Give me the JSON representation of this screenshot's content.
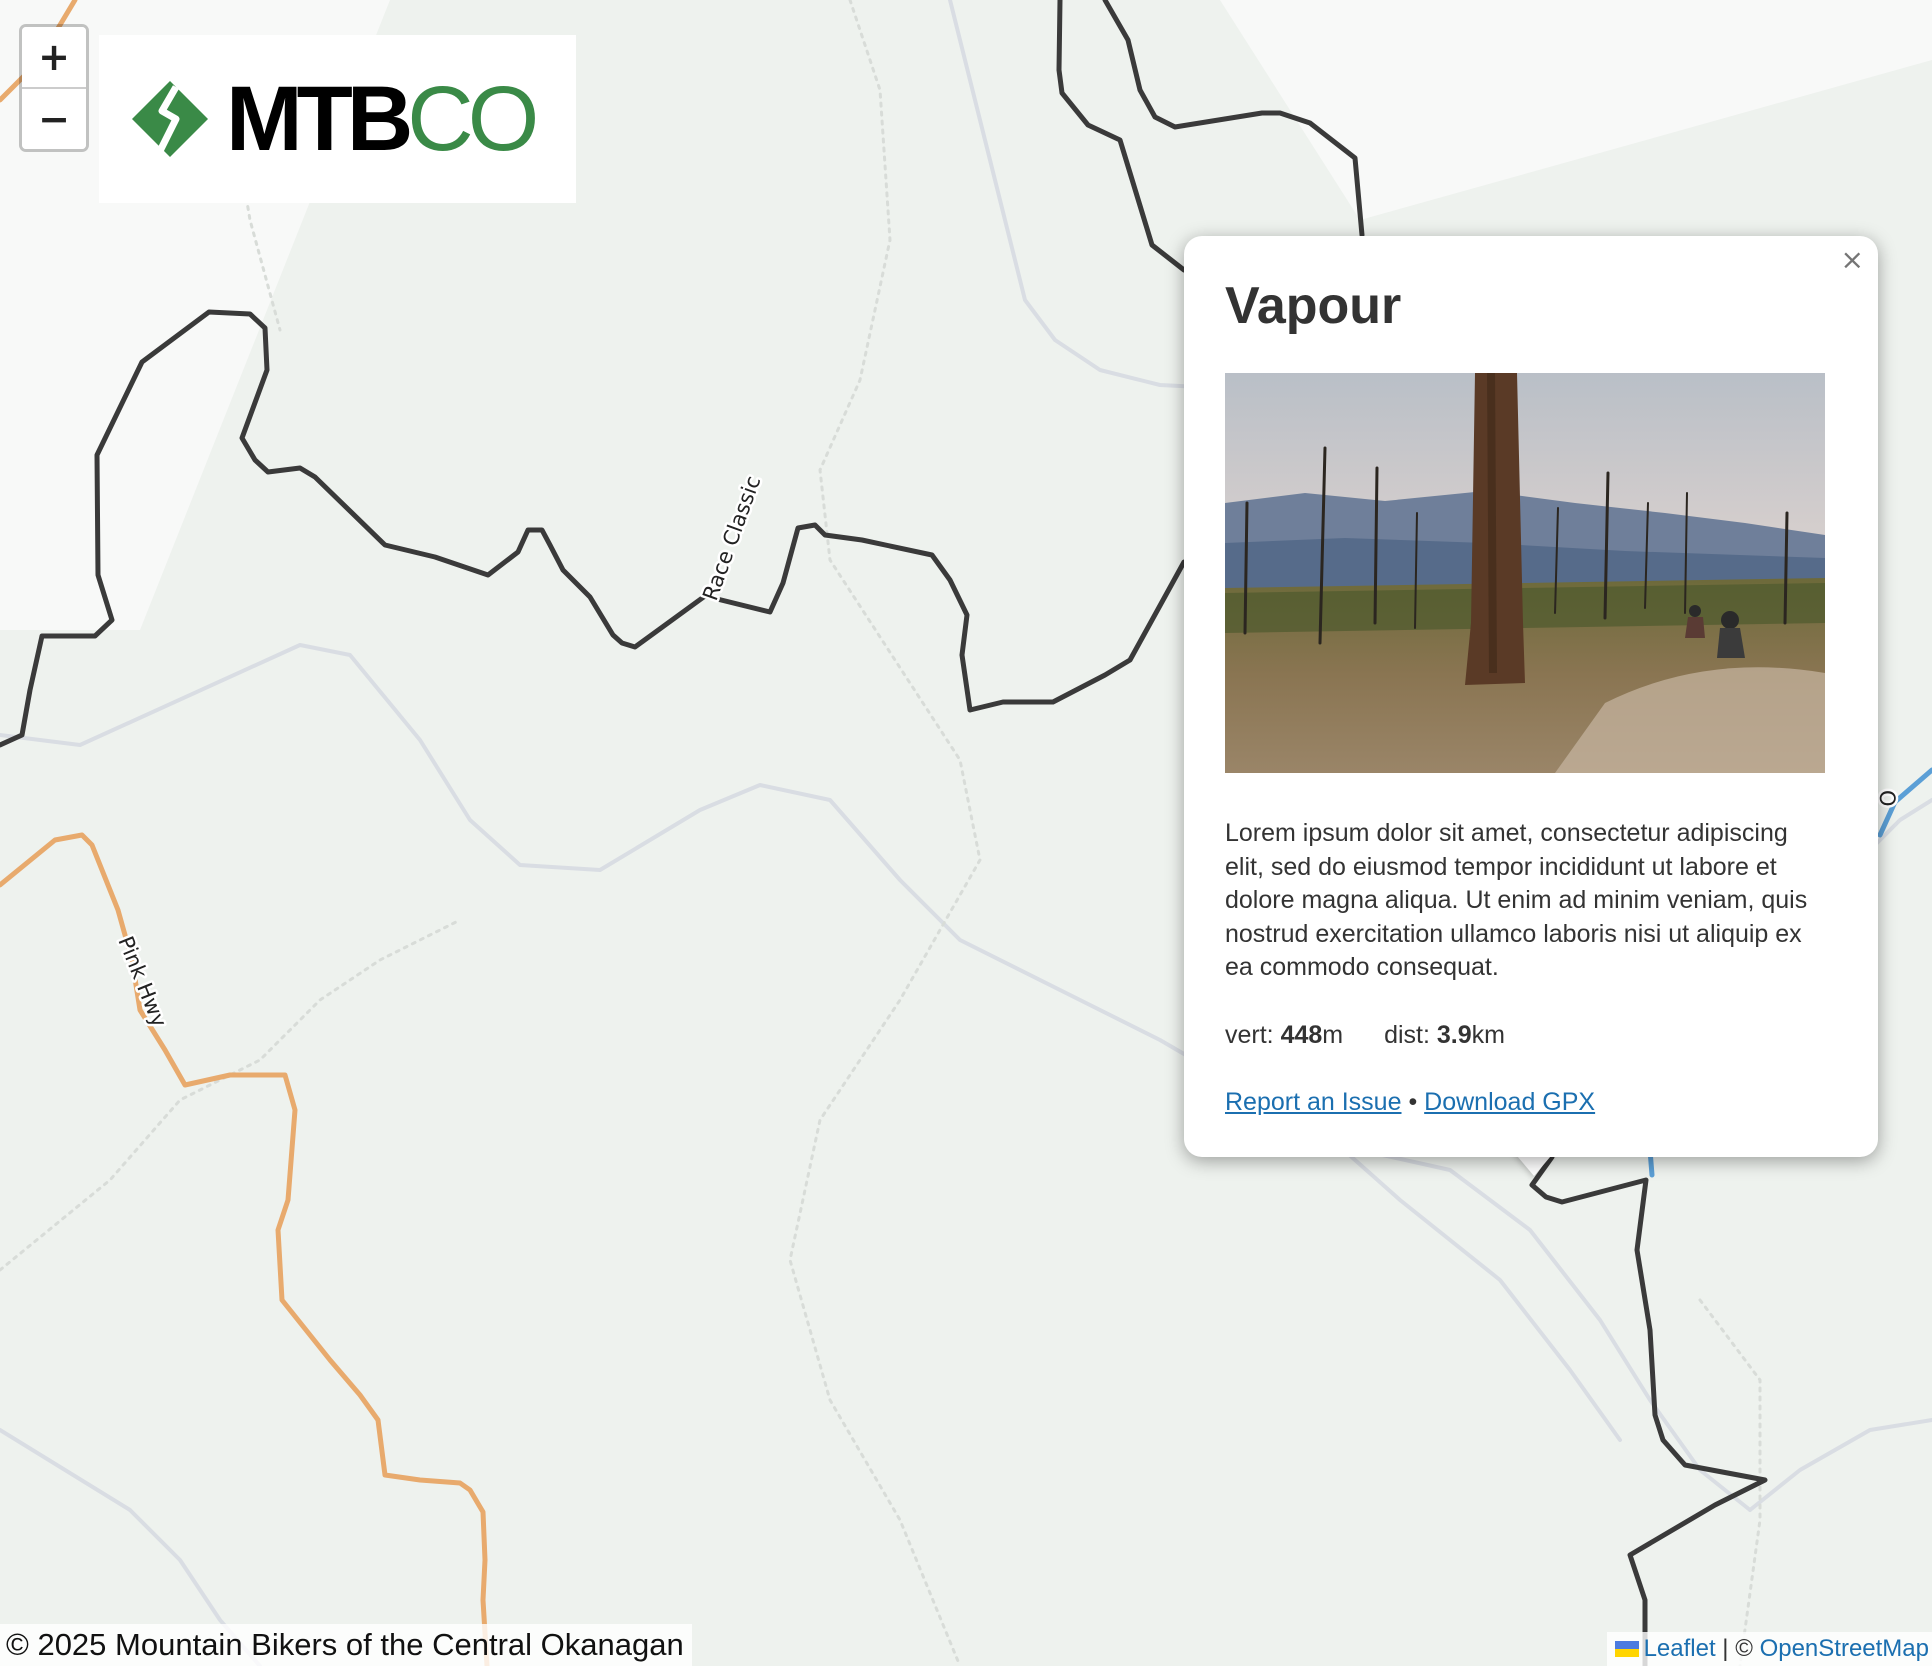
{
  "map": {
    "zoom_in_label": "+",
    "zoom_out_label": "−",
    "trail_labels": {
      "race_classic": "Race Classic",
      "pink_hwy": "Pink Hwy",
      "edge_label": "O"
    }
  },
  "logo": {
    "mtb_text": "MTB",
    "co_text": "CO",
    "brand_green": "#3a8a47"
  },
  "popup": {
    "close_label": "×",
    "title": "Vapour",
    "photo_icon": "trail-photo",
    "description": "Lorem ipsum dolor sit amet, consectetur adipiscing elit, sed do eiusmod tempor incididunt ut labore et dolore magna aliqua. Ut enim ad minim veniam, quis nostrud exercitation ullamco laboris nisi ut aliquip ex ea commodo consequat.",
    "stats": {
      "vert_label": "vert:",
      "vert_value": "448",
      "vert_unit": "m",
      "dist_label": "dist:",
      "dist_value": "3.9",
      "dist_unit": "km"
    },
    "links": {
      "report": "Report an Issue",
      "separator": "•",
      "download": "Download GPX"
    }
  },
  "attribution": {
    "copyright": "© 2025 Mountain Bikers of the Central Okanagan",
    "leaflet": "Leaflet",
    "separator": "|",
    "osm_prefix": "©",
    "osm": "OpenStreetMap"
  },
  "colors": {
    "trail_dark": "#3a3a3a",
    "trail_orange": "#e8aa6d",
    "trail_blue": "#5b9fd6",
    "contour": "#d9dde3",
    "background": "#eef2ee",
    "link": "#1b6fb0"
  }
}
